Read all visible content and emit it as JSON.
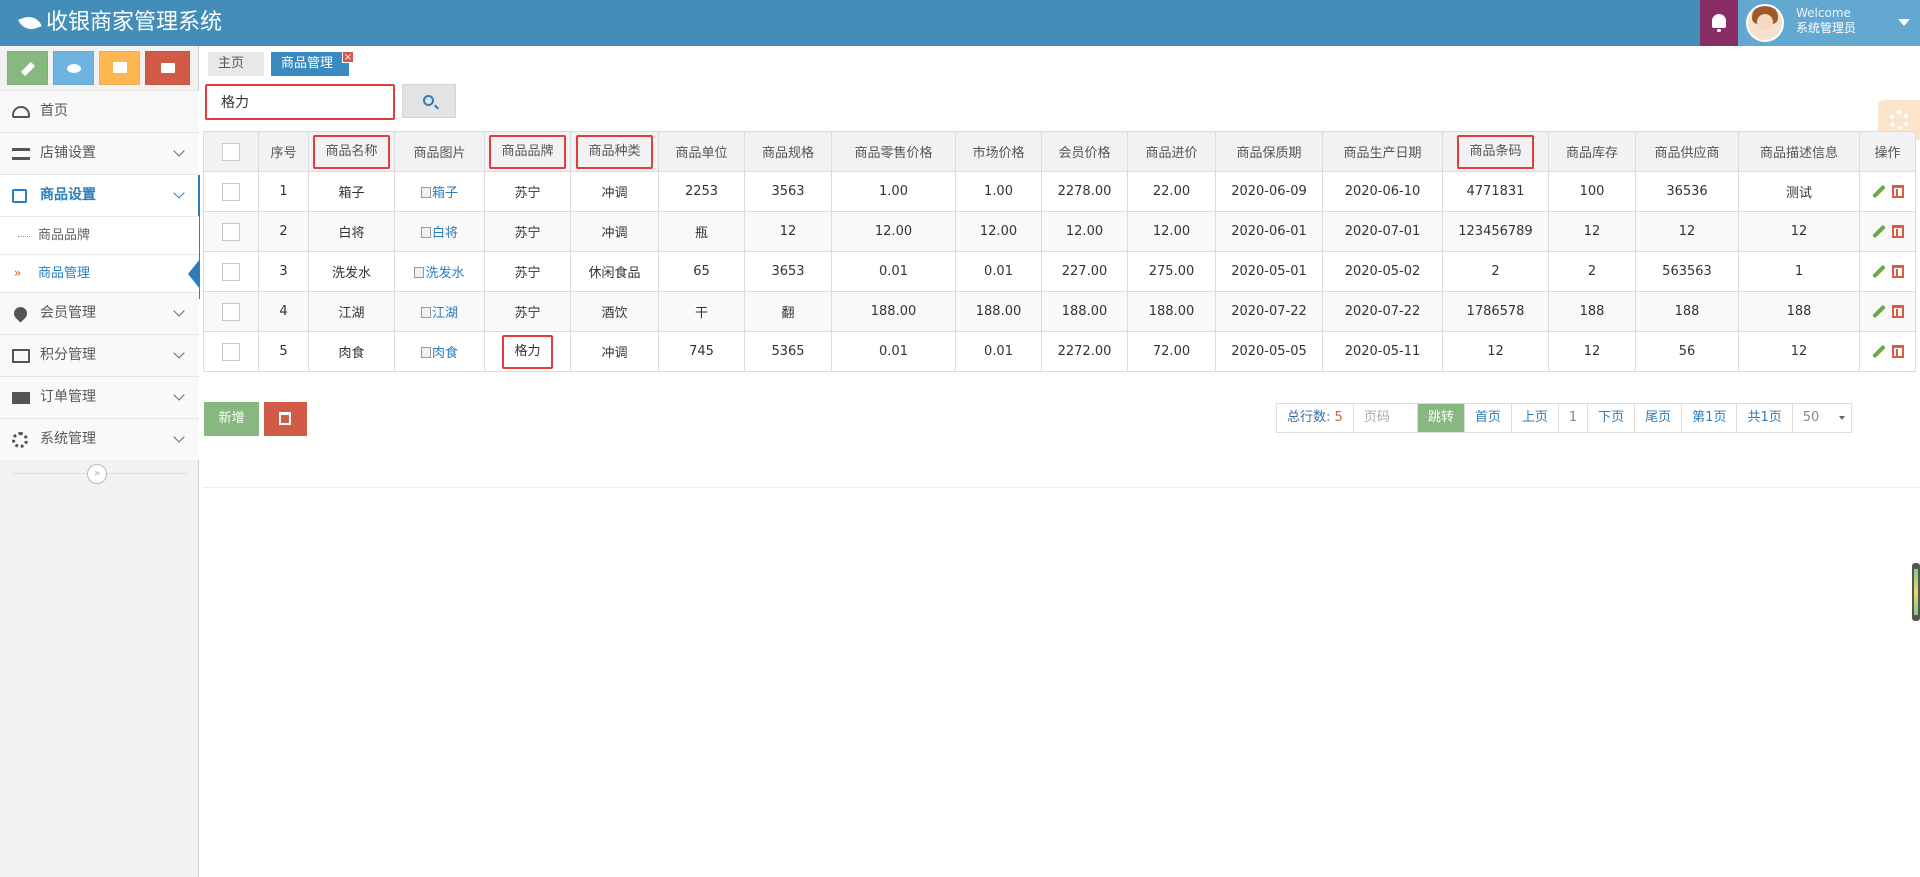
{
  "app": {
    "title": "收银商家管理系统"
  },
  "user": {
    "welcome": "Welcome",
    "name": "系统管理员"
  },
  "sidebar": {
    "items": [
      {
        "label": "首页"
      },
      {
        "label": "店铺设置"
      },
      {
        "label": "商品设置"
      },
      {
        "label": "会员管理"
      },
      {
        "label": "积分管理"
      },
      {
        "label": "订单管理"
      },
      {
        "label": "系统管理"
      }
    ],
    "subitems": [
      {
        "label": "商品品牌"
      },
      {
        "label": "商品管理"
      }
    ]
  },
  "tabs": {
    "home": "主页",
    "current": "商品管理",
    "close": "×"
  },
  "search": {
    "value": "格力"
  },
  "table": {
    "headers": [
      "序号",
      "商品名称",
      "商品图片",
      "商品品牌",
      "商品种类",
      "商品单位",
      "商品规格",
      "商品零售价格",
      "市场价格",
      "会员价格",
      "商品进价",
      "商品保质期",
      "商品生产日期",
      "商品条码",
      "商品库存",
      "商品供应商",
      "商品描述信息",
      "操作"
    ],
    "rows": [
      [
        "1",
        "箱子",
        "箱子",
        "苏宁",
        "冲调",
        "2253",
        "3563",
        "1.00",
        "1.00",
        "2278.00",
        "22.00",
        "2020-06-09",
        "2020-06-10",
        "4771831",
        "100",
        "36536",
        "测试"
      ],
      [
        "2",
        "白将",
        "白将",
        "苏宁",
        "冲调",
        "瓶",
        "12",
        "12.00",
        "12.00",
        "12.00",
        "12.00",
        "2020-06-01",
        "2020-07-01",
        "123456789",
        "12",
        "12",
        "12"
      ],
      [
        "3",
        "洗发水",
        "洗发水",
        "苏宁",
        "休闲食品",
        "65",
        "3653",
        "0.01",
        "0.01",
        "227.00",
        "275.00",
        "2020-05-01",
        "2020-05-02",
        "2",
        "2",
        "563563",
        "1"
      ],
      [
        "4",
        "江湖",
        "江湖",
        "苏宁",
        "酒饮",
        "干",
        "翻",
        "188.00",
        "188.00",
        "188.00",
        "188.00",
        "2020-07-22",
        "2020-07-22",
        "1786578",
        "188",
        "188",
        "188"
      ],
      [
        "5",
        "肉食",
        "肉食",
        "格力",
        "冲调",
        "745",
        "5365",
        "0.01",
        "0.01",
        "2272.00",
        "72.00",
        "2020-05-05",
        "2020-05-11",
        "12",
        "12",
        "56",
        "12"
      ]
    ]
  },
  "actions": {
    "add": "新增"
  },
  "pager": {
    "total_label": "总行数:",
    "total": "5",
    "page_placeholder": "页码",
    "jump": "跳转",
    "first": "首页",
    "prev": "上页",
    "current": "1",
    "next": "下页",
    "last": "尾页",
    "page_n": "第1页",
    "page_count": "共1页",
    "page_size": "50"
  },
  "colors": {
    "header": "#438eb9",
    "accent": "#2b7dbc",
    "highlight": "#e23c3c",
    "add": "#87b87f",
    "delete": "#d15b47"
  }
}
